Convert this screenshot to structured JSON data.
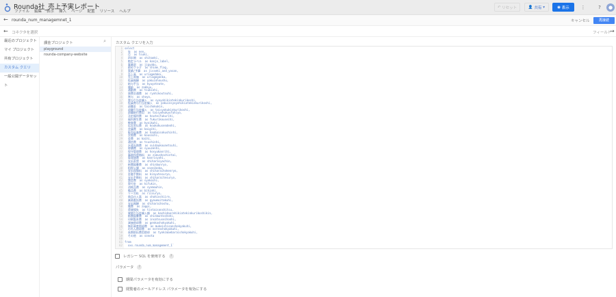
{
  "header": {
    "title": "Rounda社_売上予実レポート",
    "menu": [
      "ファイル",
      "編集",
      "表示",
      "挿入",
      "ページ",
      "配置",
      "リソース",
      "ヘルプ"
    ],
    "reset": "リセット",
    "share": "共有",
    "view": "表示"
  },
  "datasource": {
    "name": "rounda_num_managemnet_1",
    "cancel": "キャンセル",
    "reconnect": "再接続"
  },
  "connector": {
    "back_label": "コネクタを選択",
    "fields": "フィールド"
  },
  "nav": {
    "items": [
      "最近のプロジェクト",
      "マイ プロジェクト",
      "共有プロジェクト",
      "カスタム クエリ",
      "一般公開データセット"
    ]
  },
  "projects": {
    "header": "課金プロジェクト",
    "items": [
      "playground",
      "rounda-company-website"
    ]
  },
  "query": {
    "header": "カスタム クエリを入力",
    "lines": [
      "select",
      "  年  as nen,",
      "  月  as tsuki,",
      "  四半期  as shihanki,",
      "  勘定ラベル  as kanjo_label,",
      "  事業部  as jigyobu,",
      "  締めフラグ  as shime_flag,",
      "  実績/予算  as jisseki_and_yosan,",
      "  売上高  as uriagedaka,",
      "  売上原価  as uriagegenka,",
      "  役員報酬  as yakuinhoushu,",
      "  給与手当  as kyuyoteate,",
      "  雑給  as zakkyu,",
      "  通勤費  as tsukinhi,",
      "  旅費交通費  as ryohikoutsuhi,",
      "  賞与  as shoyo,",
      "  賞与引当金繰入  as syoyohikiatekinkurikoshi,",
      "  役員賞与引当金繰入  as yakuinsyoyohikiatekinkurikoshi,",
      "  退職金  as taishokukin,",
      "  退職引当金繰入  as taisyokukinkurikoshi,",
      "  退職給付費用  as taisyokukyufuhiyo,",
      "  法定福利費  as houteifukurihi,",
      "  福利厚生費  as fukurikouseihi,",
      "  教育費  as kyoikuhi,",
      "  広告宣伝費  as koukokusendenhi,",
      "  会議費  as kaigihi,",
      "  販売促進費  as hanbaisokushinhi,",
      "  交際費  as kousaihi,",
      "  会費  as kaihi,",
      "  通信費  as tsushinhi,",
      "  水道光熱費  as suidoukounetsuhi,",
      "  修繕費  as syuuzenhi,",
      "  保守管理費  as hosyukanrihi,",
      "  事務所賃借料  as zimushochintai,",
      "  管理諸費  as kanrisyohi,",
      "  支払家賃  as shiharaiyachin,",
      "  新聞図書費  as shinbunryo,",
      "  租税公課  as sozeikoka,",
      "  支払保険料  as shiharaihokenryo,",
      "  金融手数料  as kinyutesuryo,",
      "  支払手数料  as shiharaitesuryo,",
      "  諸会費  as syokaihi,",
      "  寄付金  as kifukin,",
      "  消耗品費  as syomouhin,",
      "  備品費  as bihinhi,",
      "  リース料  as riisuryo,",
      "  商品仕入高  as shohinshiire,",
      "  業務委託費  as gyoumuitakuhi,",
      "  支払報酬  as shiharaihoshu,",
      "  雑費  as zappi,",
      "  賃貸損失  as tintaisonshitsu,",
      "  貸倒引当金繰入額  as kashidaorehikiatekinkurikoshikin,",
      "  新聞図書費  as shinbuntoshohi,",
      "  印刷製本費  as insatsuseihonhi,",
      "  減価償却費  as genkashokyakuhi,",
      "  無形資産償却費  as mukeishisanshokyakuhi,",
      "  のれん償却費  as norenshokyakuhi,",
      "  長期前払費用償却  as tyokimaebaraishokyakuhi,",
      "  その他  as sonota",
      "",
      "from",
      "  xxx.rounda_num_management_1`"
    ]
  },
  "options": {
    "legacy_sql": "レガシー SQL を使用する",
    "parameters": "パラメータ",
    "date_param": "期間パラメータを有効にする",
    "email_param": "閲覧者のメールアドレス パラメータを有効にする"
  }
}
